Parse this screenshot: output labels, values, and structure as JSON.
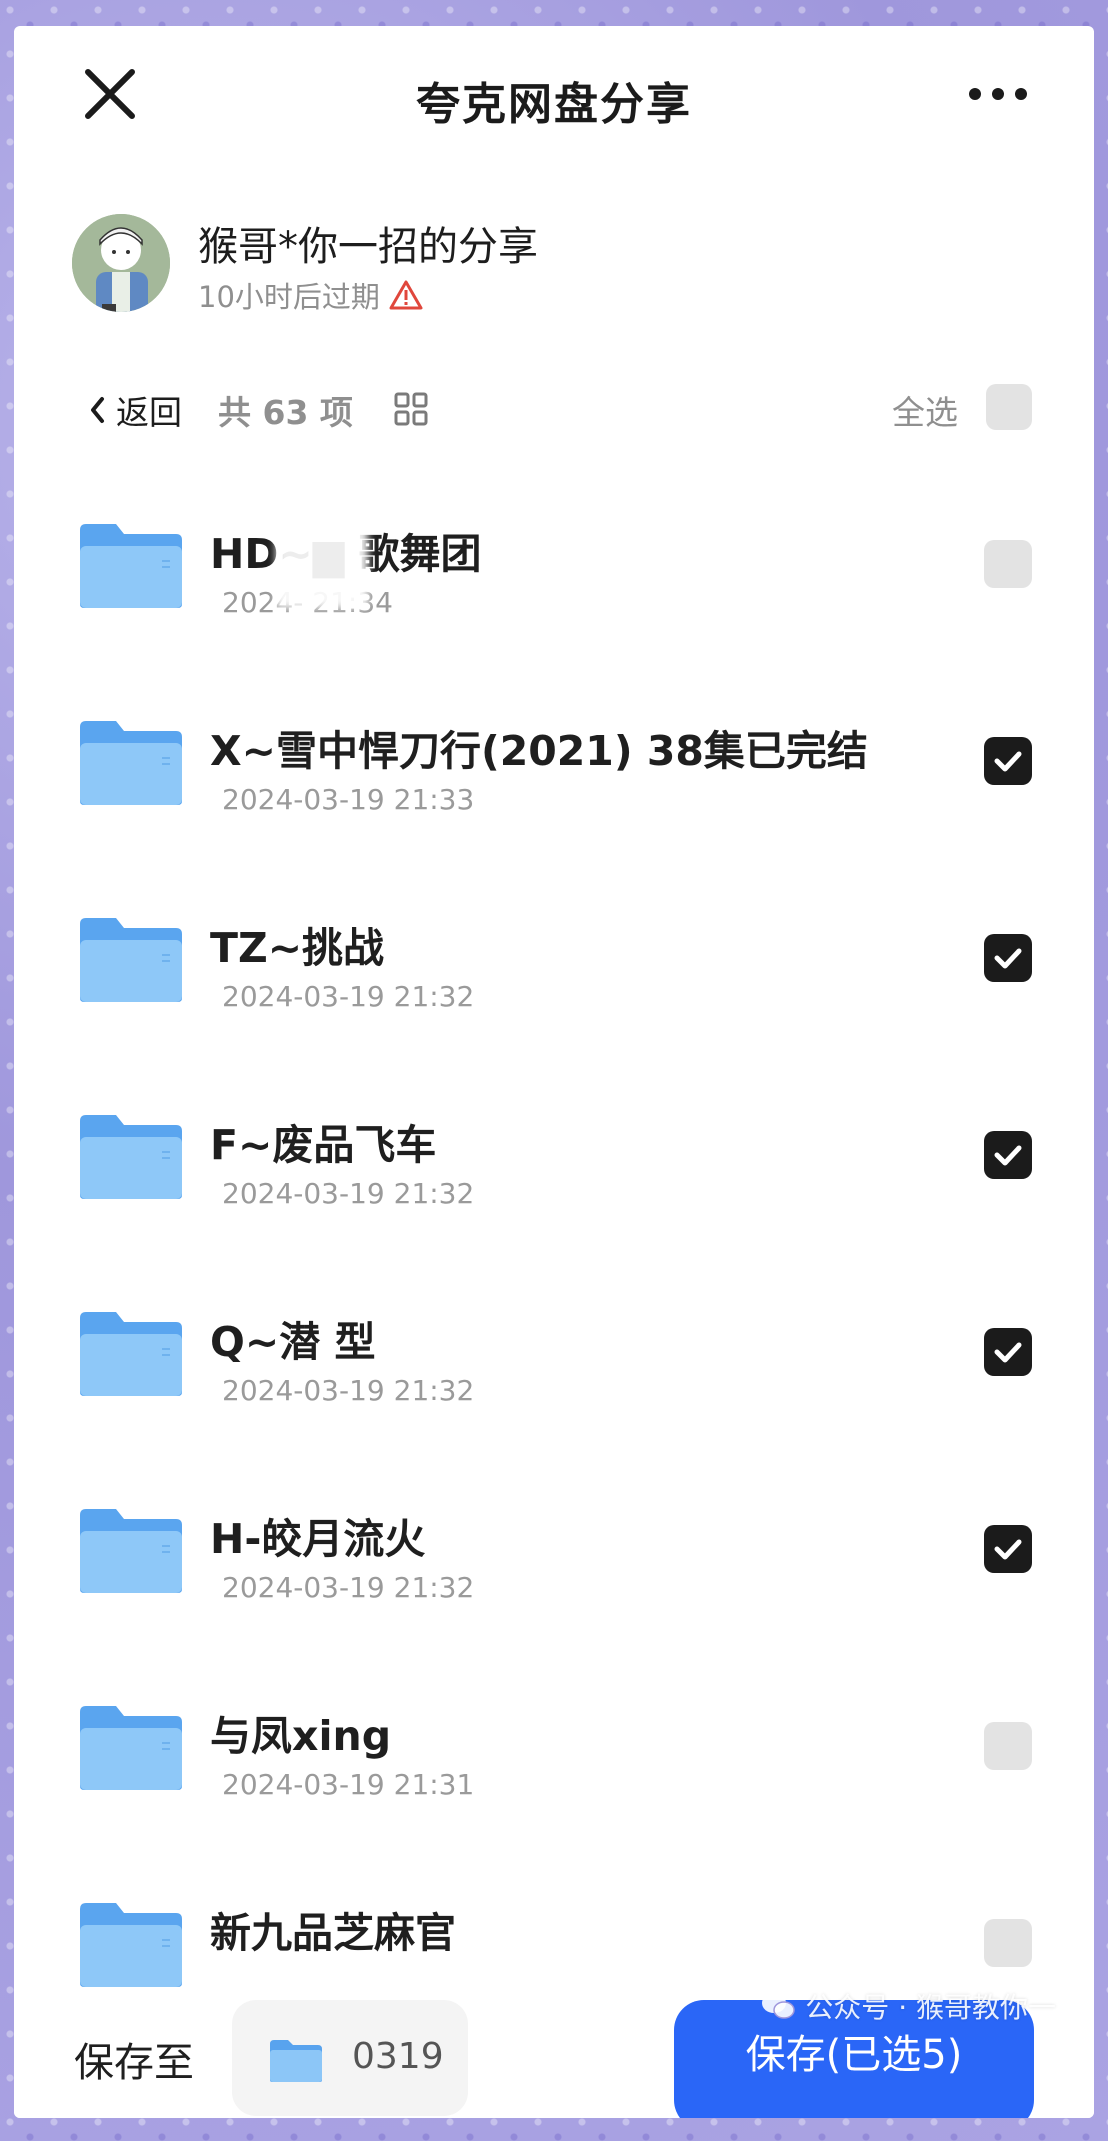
{
  "header": {
    "title": "夸克网盘分享"
  },
  "sharer": {
    "name": "猴哥*你一招的分享",
    "expire": "10小时后过期"
  },
  "toolbar": {
    "back": "返回",
    "count": "共 63 项",
    "select_all": "全选"
  },
  "files": [
    {
      "name": "HD~▆ 歌舞团",
      "date": "2024-  21:34",
      "checked": false
    },
    {
      "name": "X~雪中悍刀行(2021) 38集已完结",
      "date": "2024-03-19 21:33",
      "checked": true
    },
    {
      "name": "TZ~挑战",
      "date": "2024-03-19 21:32",
      "checked": true
    },
    {
      "name": "F~废品飞车",
      "date": "2024-03-19 21:32",
      "checked": true
    },
    {
      "name": "Q~潜 型",
      "date": "2024-03-19 21:32",
      "checked": true
    },
    {
      "name": "H-皎月流火",
      "date": "2024-03-19 21:32",
      "checked": true
    },
    {
      "name": "与凤xing",
      "date": "2024-03-19 21:31",
      "checked": false
    },
    {
      "name": "新九品芝麻官",
      "date": "",
      "checked": false
    }
  ],
  "bottom": {
    "save_to": "保存至",
    "destination": "0319",
    "save_button": "保存(已选5)"
  },
  "watermark": "公众号 · 猴哥教你一",
  "colors": {
    "accent": "#2a66f7",
    "checkbox_checked": "#1b1b1b",
    "folder": "#6cb2f3"
  }
}
